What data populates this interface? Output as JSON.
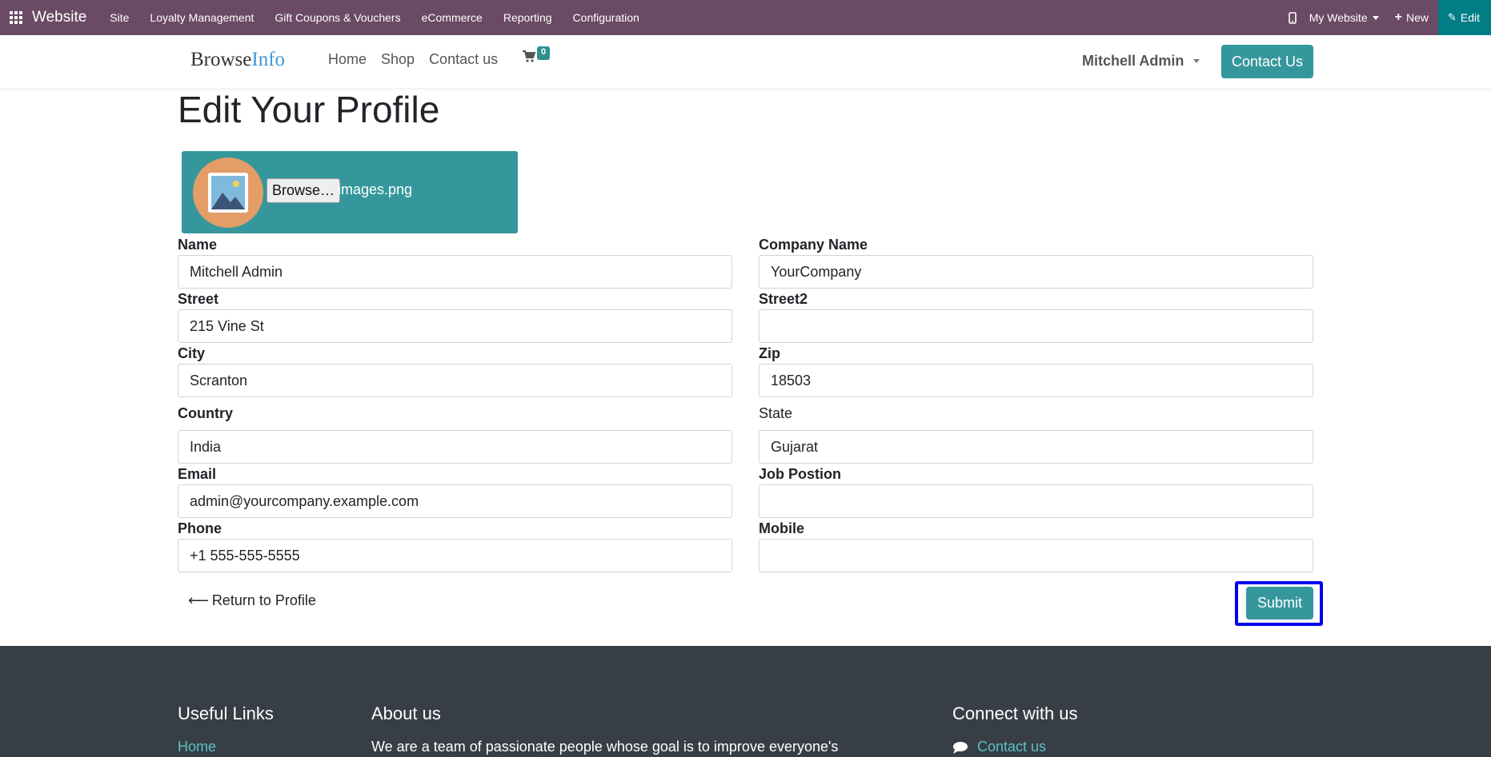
{
  "admin_bar": {
    "brand": "Website",
    "menu": [
      "Site",
      "Loyalty Management",
      "Gift Coupons & Vouchers",
      "eCommerce",
      "Reporting",
      "Configuration"
    ],
    "site_switcher": "My Website",
    "new_label": "New",
    "edit_label": "Edit",
    "color": "#6a4a64",
    "edit_color": "#017e84"
  },
  "header": {
    "logo_part1": "Browse",
    "logo_part2": "Info",
    "nav": [
      "Home",
      "Shop",
      "Contact us"
    ],
    "cart_count": "0",
    "user_name": "Mitchell Admin",
    "contact_button": "Contact Us",
    "accent_color": "#35979c"
  },
  "page": {
    "title": "Edit Your Profile",
    "browse_button": "Browse…",
    "file_name": "images.png"
  },
  "form": {
    "name_label": "Name",
    "name_value": "Mitchell Admin",
    "company_label": "Company Name",
    "company_value": "YourCompany",
    "street_label": "Street",
    "street_value": "215 Vine St",
    "street2_label": "Street2",
    "street2_value": "",
    "city_label": "City",
    "city_value": "Scranton",
    "zip_label": "Zip",
    "zip_value": "18503",
    "country_label": "Country",
    "country_value": "India",
    "state_label": "State",
    "state_value": "Gujarat",
    "email_label": "Email",
    "email_value": "admin@yourcompany.example.com",
    "job_label": "Job Postion",
    "job_value": "",
    "phone_label": "Phone",
    "phone_value": "+1 555-555-5555",
    "mobile_label": "Mobile",
    "mobile_value": ""
  },
  "actions": {
    "return_label": "Return to Profile",
    "submit_label": "Submit"
  },
  "footer": {
    "useful_links_heading": "Useful Links",
    "useful_links_first": "Home",
    "about_heading": "About us",
    "about_text": "We are a team of passionate people whose goal is to improve everyone's",
    "connect_heading": "Connect with us",
    "connect_link": "Contact us",
    "background": "#383e45"
  }
}
